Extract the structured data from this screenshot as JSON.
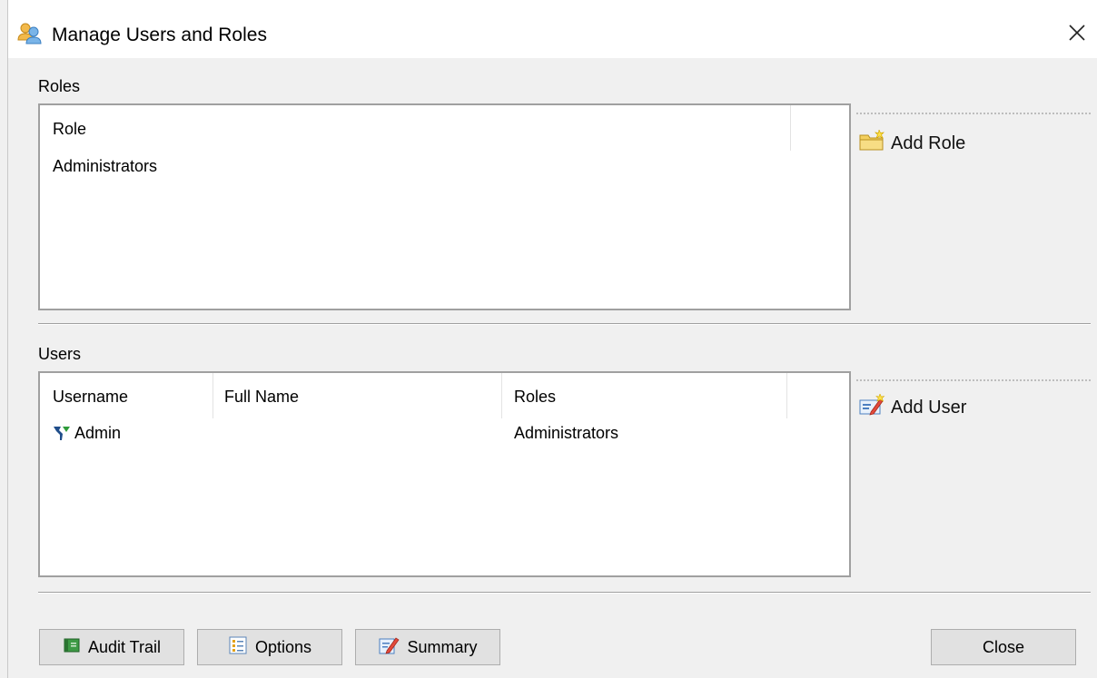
{
  "window": {
    "title": "Manage Users and Roles",
    "close_symbol": "✕"
  },
  "roles": {
    "section_label": "Roles",
    "column_header": "Role",
    "items": [
      "Administrators"
    ],
    "add_label": "Add Role",
    "add_icon": "folder-new-icon"
  },
  "users": {
    "section_label": "Users",
    "columns": [
      "Username",
      "Full Name",
      "Roles"
    ],
    "rows": [
      {
        "username": "Admin",
        "full_name": "",
        "roles": "Administrators",
        "icon": "admin-user-icon"
      }
    ],
    "add_label": "Add User",
    "add_icon": "add-user-icon"
  },
  "footer": {
    "audit_trail_label": "Audit Trail",
    "options_label": "Options",
    "summary_label": "Summary",
    "close_label": "Close"
  },
  "colors": {
    "window_bg": "#f0f0f0",
    "border": "#a0a0a0",
    "button_bg": "#e1e1e1"
  }
}
